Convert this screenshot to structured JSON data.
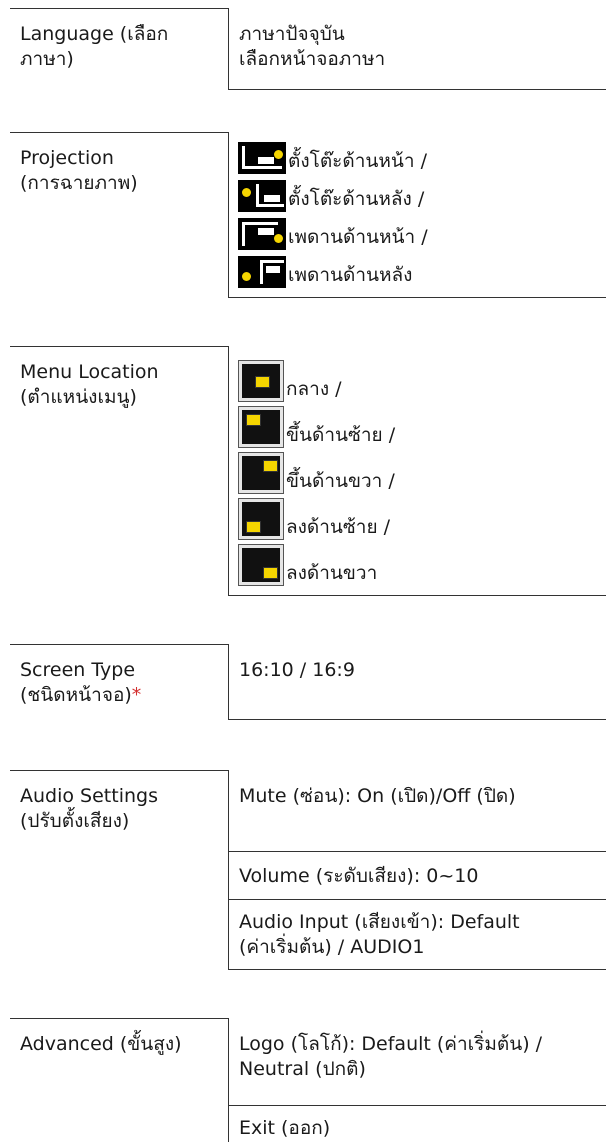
{
  "rows": {
    "language": {
      "label": "Language (เลือก\nภาษา)",
      "value": "ภาษาปัจจุบัน\nเลือกหน้าจอภาษา"
    },
    "projection": {
      "label": "Projection\n(การฉายภาพ)",
      "options": [
        "ตั้งโต๊ะด้านหน้า /",
        "ตั้งโต๊ะด้านหลัง /",
        "เพดานด้านหน้า /",
        "เพดานด้านหลัง"
      ]
    },
    "menu_location": {
      "label": "Menu Location\n(ตำแหน่งเมนู)",
      "options": [
        "กลาง /",
        "ขึ้นด้านซ้าย /",
        "ขึ้นด้านขวา /",
        "ลงด้านซ้าย /",
        "ลงด้านขวา"
      ]
    },
    "screen_type": {
      "label": "Screen Type\n(ชนิดหน้าจอ)",
      "star": "*",
      "value": "16:10 / 16:9"
    },
    "audio": {
      "label": "Audio Settings\n(ปรับตั้งเสียง)",
      "items": [
        "Mute (ซ่อน): On (เปิด)/Off (ปิด)",
        "Volume (ระดับเสียง): 0~10",
        "Audio Input (เสียงเข้า): Default\n(ค่าเริ่มต้น) / AUDIO1"
      ]
    },
    "advanced": {
      "label": "Advanced (ขั้นสูง)",
      "items": [
        "Logo (โลโก้): Default (ค่าเริ่มต้น) /\nNeutral (ปกติ)",
        "Exit (ออก)"
      ]
    }
  },
  "colors": {
    "accent_star": "#d32f2f",
    "icon_yellow": "#f5d500"
  }
}
